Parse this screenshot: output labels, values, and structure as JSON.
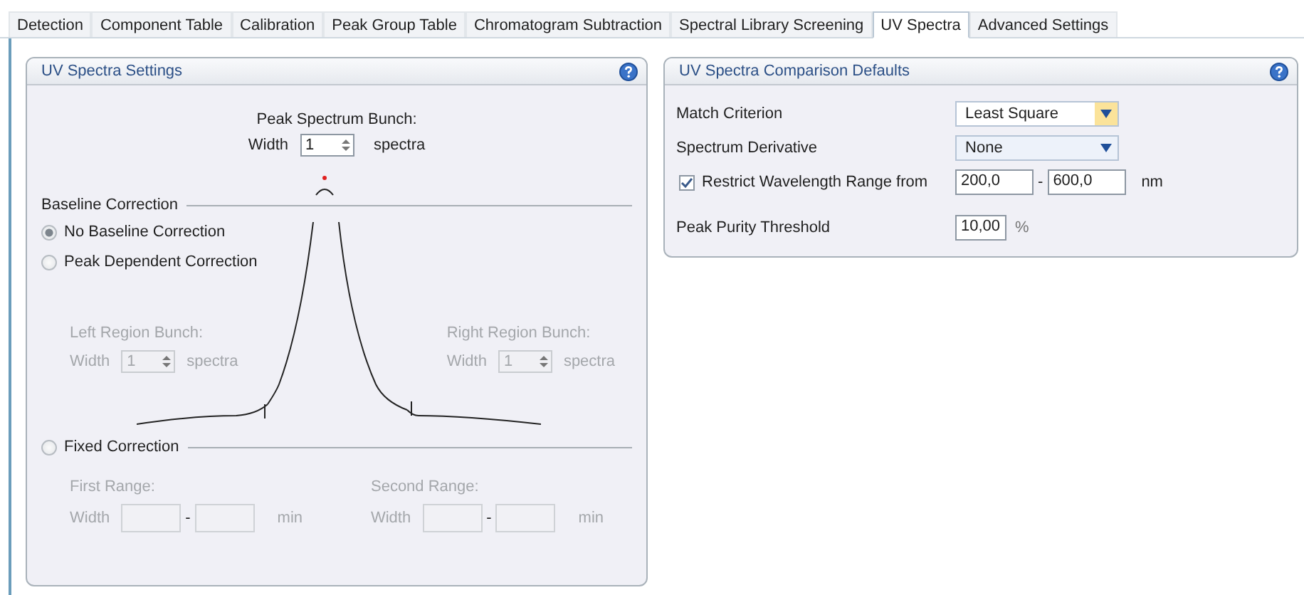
{
  "tabs": [
    {
      "label": "Detection",
      "selected": false
    },
    {
      "label": "Component Table",
      "selected": false
    },
    {
      "label": "Calibration",
      "selected": false
    },
    {
      "label": "Peak Group Table",
      "selected": false
    },
    {
      "label": "Chromatogram Subtraction",
      "selected": false
    },
    {
      "label": "Spectral Library Screening",
      "selected": false
    },
    {
      "label": "UV Spectra",
      "selected": true
    },
    {
      "label": "Advanced Settings",
      "selected": false
    }
  ],
  "settings_panel": {
    "title": "UV Spectra Settings",
    "peak_spectrum_bunch": {
      "label": "Peak Spectrum Bunch:",
      "width_label": "Width",
      "value": "1",
      "unit": "spectra"
    },
    "baseline_correction": {
      "title": "Baseline Correction",
      "options": [
        {
          "label": "No Baseline Correction",
          "selected": true
        },
        {
          "label": "Peak Dependent Correction",
          "selected": false
        }
      ]
    },
    "region_bunches": [
      {
        "label": "Left Region Bunch:",
        "width_label": "Width",
        "value": "1",
        "unit": "spectra",
        "disabled": true
      },
      {
        "label": "Right Region Bunch:",
        "width_label": "Width",
        "value": "1",
        "unit": "spectra",
        "disabled": true
      }
    ],
    "fixed_correction": {
      "label": "Fixed Correction",
      "selected": false
    },
    "ranges": [
      {
        "label": "First Range:",
        "width_label": "Width",
        "separator": "-",
        "unit": "min",
        "disabled": true
      },
      {
        "label": "Second Range:",
        "width_label": "Width",
        "separator": "-",
        "unit": "min",
        "disabled": true
      }
    ]
  },
  "comparison_panel": {
    "title": "UV Spectra Comparison Defaults",
    "rows": [
      {
        "kind": "dropdown",
        "label": "Match Criterion",
        "value": "Least Square",
        "highlighted": true
      },
      {
        "kind": "dropdown",
        "label": "Spectrum Derivative",
        "value": "None",
        "highlighted": false
      },
      {
        "kind": "range",
        "label": "Restrict Wavelength Range from",
        "checked": true,
        "from": "200,0",
        "separator": "-",
        "to": "600,0",
        "unit": "nm"
      },
      {
        "kind": "number",
        "label": "Peak Purity Threshold",
        "value": "10,00",
        "unit": "%"
      }
    ]
  }
}
